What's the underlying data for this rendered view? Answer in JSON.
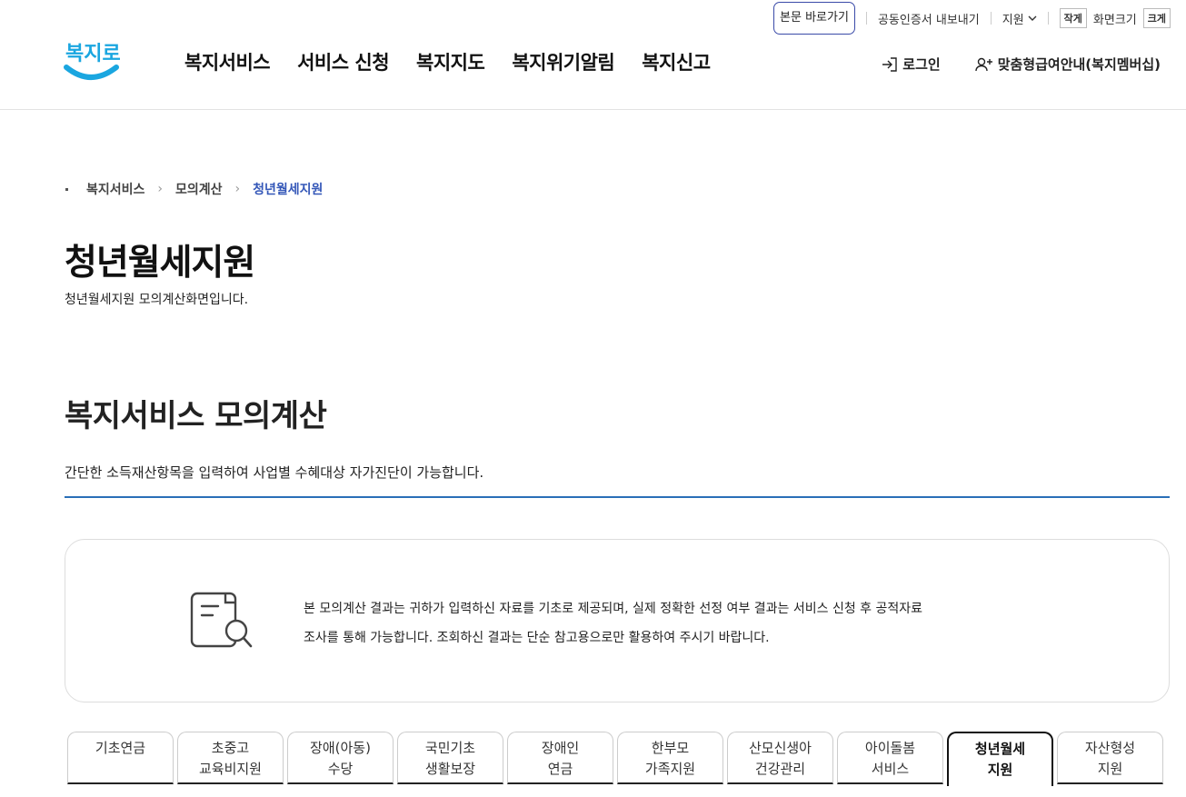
{
  "util": {
    "skip": "본문 바로가기",
    "cert": "공동인증서 내보내기",
    "support": "지원",
    "font_small": "작게",
    "font_label": "화면크기",
    "font_large": "크게"
  },
  "logo": {
    "text": "복지로",
    "accent": "#1aa6e0"
  },
  "gnb": [
    "복지서비스",
    "서비스 신청",
    "복지지도",
    "복지위기알림",
    "복지신고"
  ],
  "header_right": {
    "login": "로그인",
    "membership": "맞춤형급여안내(복지멤버십)"
  },
  "breadcrumb": {
    "items": [
      "복지서비스",
      "모의계산"
    ],
    "current": "청년월세지원"
  },
  "page": {
    "title": "청년월세지원",
    "desc": "청년월세지원 모의계산화면입니다."
  },
  "section": {
    "title": "복지서비스 모의계산",
    "desc": "간단한 소득재산항목을 입력하여 사업별 수혜대상 자가진단이 가능합니다."
  },
  "notice": {
    "line1": "본 모의계산 결과는 귀하가 입력하신 자료를 기초로 제공되며, 실제 정확한 선정 여부 결과는 서비스 신청 후 공적자료",
    "line2": "조사를 통해 가능합니다. 조회하신 결과는 단순 참고용으로만 활용하여 주시기 바랍니다."
  },
  "tabs": [
    {
      "l1": "기초연금",
      "l2": ""
    },
    {
      "l1": "초중고",
      "l2": "교육비지원"
    },
    {
      "l1": "장애(아동)",
      "l2": "수당"
    },
    {
      "l1": "국민기초",
      "l2": "생활보장"
    },
    {
      "l1": "장애인",
      "l2": "연금"
    },
    {
      "l1": "한부모",
      "l2": "가족지원"
    },
    {
      "l1": "산모신생아",
      "l2": "건강관리"
    },
    {
      "l1": "아이돌봄",
      "l2": "서비스"
    },
    {
      "l1": "청년월세",
      "l2": "지원"
    },
    {
      "l1": "자산형성",
      "l2": "지원"
    }
  ],
  "colors": {
    "accent_blue": "#2a6fb8",
    "breadcrumb_current": "#3457b8"
  }
}
